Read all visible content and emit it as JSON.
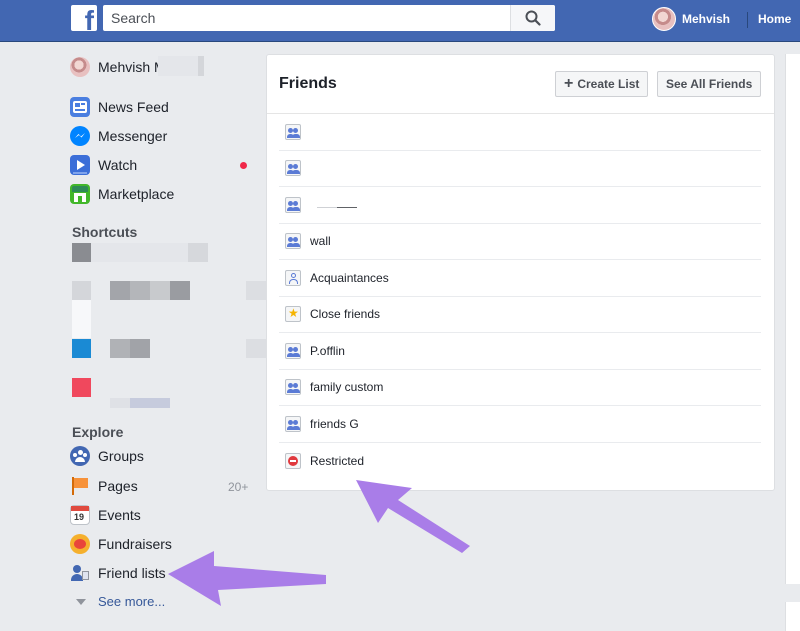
{
  "header": {
    "logo_letter": "f",
    "search_placeholder": "Search",
    "user_name": "Mehvish",
    "home_label": "Home"
  },
  "sidebar": {
    "profile_name": "Mehvish M",
    "main_items": [
      {
        "label": "News Feed",
        "icon": "news-feed-icon"
      },
      {
        "label": "Messenger",
        "icon": "messenger-icon"
      },
      {
        "label": "Watch",
        "icon": "watch-icon"
      },
      {
        "label": "Marketplace",
        "icon": "marketplace-icon"
      }
    ],
    "shortcuts_title": "Shortcuts",
    "explore_title": "Explore",
    "explore_items": [
      {
        "label": "Groups",
        "icon": "groups-icon"
      },
      {
        "label": "Pages",
        "icon": "pages-flag-icon"
      },
      {
        "label": "Events",
        "icon": "events-calendar-icon"
      },
      {
        "label": "Fundraisers",
        "icon": "fundraisers-icon"
      },
      {
        "label": "Friend lists",
        "icon": "friend-lists-icon"
      }
    ],
    "pages_count": "20+",
    "see_more": "See more..."
  },
  "friends_card": {
    "title": "Friends",
    "create_list_label": "Create List",
    "see_all_label": "See All Friends",
    "lists": [
      {
        "label": "",
        "icon": "group-list-icon"
      },
      {
        "label": "",
        "icon": "group-list-icon"
      },
      {
        "label": "",
        "icon": "group-list-icon"
      },
      {
        "label": "wall",
        "icon": "group-list-icon"
      },
      {
        "label": "Acquaintances",
        "icon": "acquaintances-icon"
      },
      {
        "label": "Close friends",
        "icon": "star-icon"
      },
      {
        "label": "P.offlin",
        "icon": "group-list-icon"
      },
      {
        "label": "family custom",
        "icon": "group-list-icon"
      },
      {
        "label": "friends G",
        "icon": "group-list-icon"
      },
      {
        "label": "Restricted",
        "icon": "restricted-icon"
      }
    ]
  },
  "colors": {
    "brand_blue": "#4267b2",
    "arrow_purple": "#a97de8",
    "background": "#e9ebee"
  }
}
